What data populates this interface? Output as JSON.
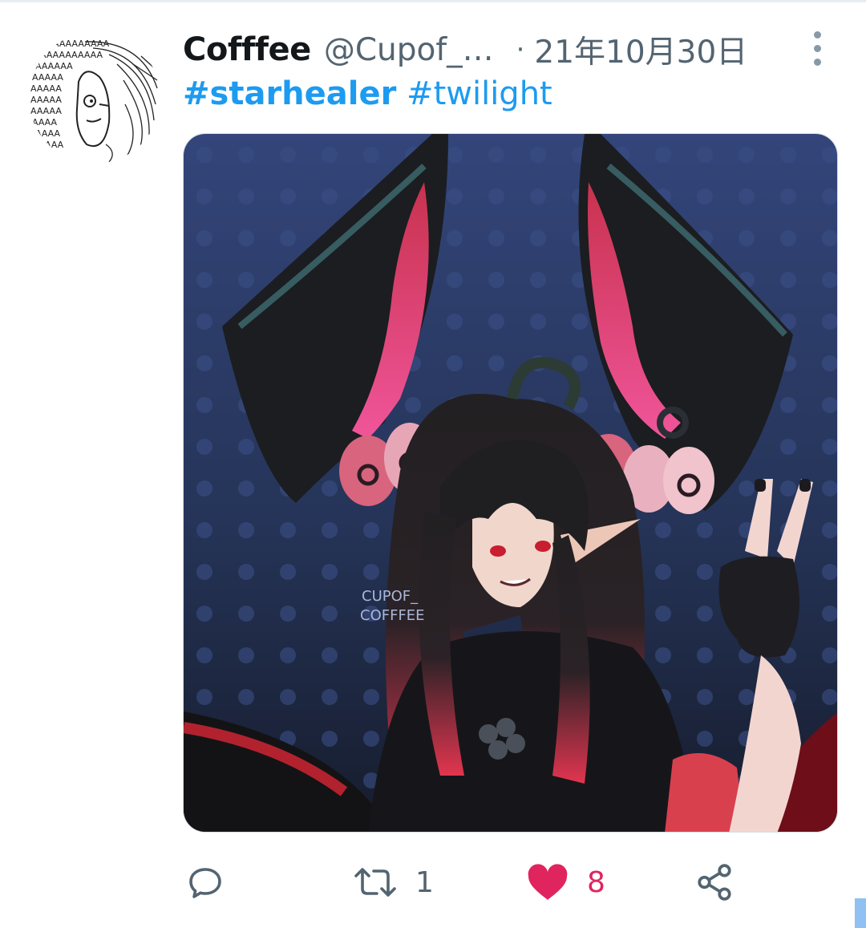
{
  "tweet": {
    "display_name": "Cofffee",
    "handle": "@Cupof_…",
    "separator": "·",
    "date": "21年10月30日",
    "hashtags": [
      "#starhealer",
      "#twilight"
    ],
    "media_watermark": [
      "CUPOF_",
      "COFFFEE"
    ]
  },
  "actions": {
    "reply_icon": "speech-bubble-icon",
    "retweet_icon": "retweet-arrows-icon",
    "retweet_count": "1",
    "like_icon": "heart-filled-icon",
    "like_count": "8",
    "share_icon": "share-nodes-icon",
    "more_icon": "vertical-ellipsis-icon"
  },
  "colors": {
    "link": "#1d9bf0",
    "secondary_text": "#536471",
    "like": "#e0245e",
    "icon": "#536471"
  }
}
